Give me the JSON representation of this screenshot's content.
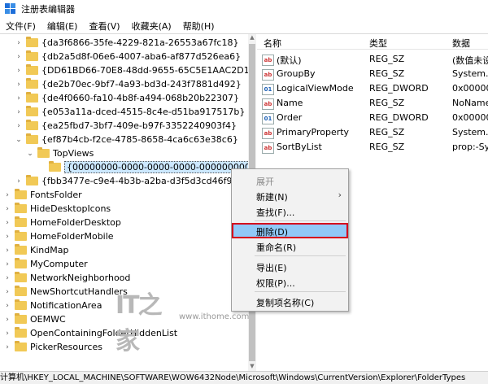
{
  "window": {
    "title": "注册表编辑器"
  },
  "menu": [
    "文件(F)",
    "编辑(E)",
    "查看(V)",
    "收藏夹(A)",
    "帮助(H)"
  ],
  "tree": {
    "guid_keys": [
      "{da3f6866-35fe-4229-821a-26553a67fc18}",
      "{db2a5d8f-06e6-4007-aba6-af877d526ea6}",
      "{DD61BD66-70E8-48dd-9655-65C5E1AAC2D1}",
      "{de2b70ec-9bf7-4a93-bd3d-243f7881d492}",
      "{de4f0660-fa10-4b8f-a494-068b20b22307}",
      "{e053a11a-dced-4515-8c4e-d51ba917517b}",
      "{ea25fbd7-3bf7-409e-b97f-3352240903f4}",
      "{ef87b4cb-f2ce-4785-8658-4ca6c63e38c6}"
    ],
    "topviews": "TopViews",
    "selected": "{00000000-0000-0000-0000-000000000000}",
    "after_key": "{fbb3477e-c9e4-4b3b-a2ba-d3f5d3cd46f9}",
    "folders": [
      "FontsFolder",
      "HideDesktopIcons",
      "HomeFolderDesktop",
      "HomeFolderMobile",
      "KindMap",
      "MyComputer",
      "NetworkNeighborhood",
      "NewShortcutHandlers",
      "NotificationArea",
      "OEMWC",
      "OpenContainingFolderHiddenList",
      "PickerResources"
    ]
  },
  "values": {
    "headers": {
      "name": "名称",
      "type": "类型",
      "data": "数据"
    },
    "rows": [
      {
        "name": "(默认)",
        "type": "REG_SZ",
        "data": "(数值未设",
        "icon": "ab"
      },
      {
        "name": "GroupBy",
        "type": "REG_SZ",
        "data": "System.S",
        "icon": "ab"
      },
      {
        "name": "LogicalViewMode",
        "type": "REG_DWORD",
        "data": "0x000000",
        "icon": "dw"
      },
      {
        "name": "Name",
        "type": "REG_SZ",
        "data": "NoName",
        "icon": "ab"
      },
      {
        "name": "Order",
        "type": "REG_DWORD",
        "data": "0x000000",
        "icon": "dw"
      },
      {
        "name": "PrimaryProperty",
        "type": "REG_SZ",
        "data": "System.S",
        "icon": "ab"
      },
      {
        "name": "SortByList",
        "type": "REG_SZ",
        "data": "prop:-Sy",
        "icon": "ab"
      }
    ]
  },
  "context_menu": {
    "expand": "展开",
    "new": "新建(N)",
    "find": "查找(F)...",
    "delete": "删除(D)",
    "rename": "重命名(R)",
    "export": "导出(E)",
    "permissions": "权限(P)...",
    "copy_key_name": "复制项名称(C)"
  },
  "status": "计算机\\HKEY_LOCAL_MACHINE\\SOFTWARE\\WOW6432Node\\Microsoft\\Windows\\CurrentVersion\\Explorer\\FolderTypes",
  "watermark": {
    "logo": "IT之家",
    "url": "www.ithome.com"
  },
  "colors": {
    "highlight": "#91c9f7",
    "highlight_border": "#d6001c",
    "folder": "#f1c956"
  }
}
